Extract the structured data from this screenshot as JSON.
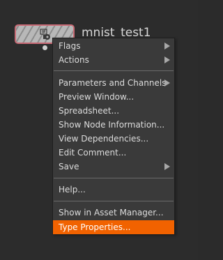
{
  "node": {
    "title": "mnist_test1",
    "border_color": "#c96a75"
  },
  "menu": {
    "highlight_color": "#f16200",
    "group1": [
      {
        "label": "Flags",
        "submenu": true
      },
      {
        "label": "Actions",
        "submenu": true
      }
    ],
    "group2": [
      {
        "label": "Parameters and Channels",
        "submenu": true
      },
      {
        "label": "Preview Window...",
        "submenu": false
      },
      {
        "label": "Spreadsheet...",
        "submenu": false
      },
      {
        "label": "Show Node Information...",
        "submenu": false
      },
      {
        "label": "View Dependencies...",
        "submenu": false
      },
      {
        "label": "Edit Comment...",
        "submenu": false
      },
      {
        "label": "Save",
        "submenu": true
      }
    ],
    "group3": [
      {
        "label": "Help...",
        "submenu": false
      }
    ],
    "group4": [
      {
        "label": "Show in Asset Manager...",
        "submenu": false
      },
      {
        "label": "Type Properties...",
        "submenu": false,
        "highlighted": true
      }
    ]
  }
}
